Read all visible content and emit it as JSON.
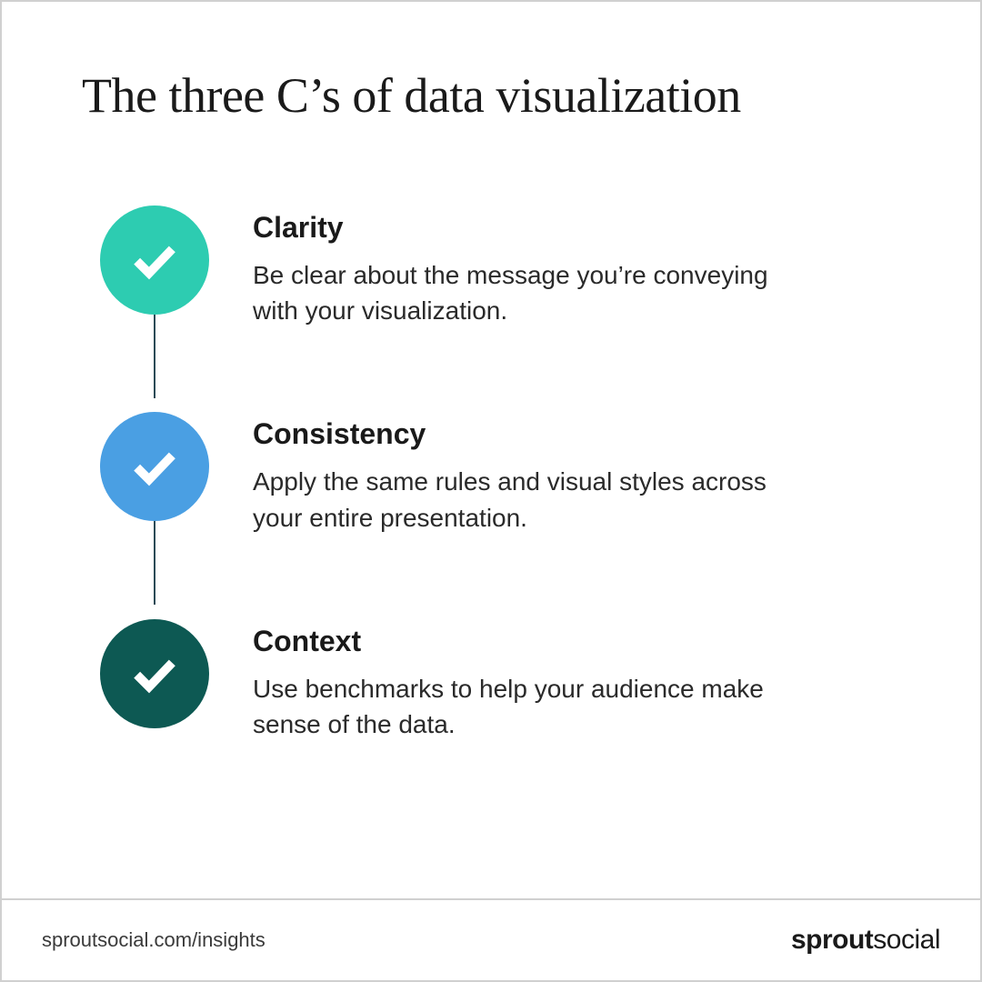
{
  "title": "The three C’s of data visualization",
  "items": [
    {
      "title": "Clarity",
      "desc": "Be clear about the message you’re conveying with your visualization.",
      "color": "#2dccb1"
    },
    {
      "title": "Consistency",
      "desc": "Apply the same rules and visual styles across your entire presentation.",
      "color": "#4a9fe3"
    },
    {
      "title": "Context",
      "desc": "Use benchmarks to help your audience make sense of the data.",
      "color": "#0d5953"
    }
  ],
  "footer": {
    "url": "sproutsocial.com/insights",
    "brand_bold": "sprout",
    "brand_light": "social"
  }
}
